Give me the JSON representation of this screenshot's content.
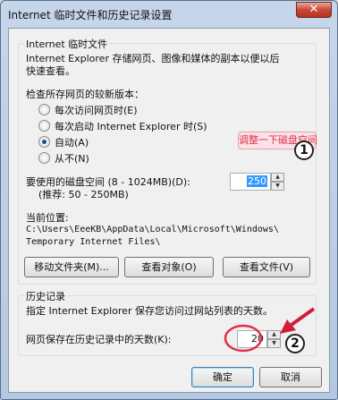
{
  "window": {
    "title": "Internet 临时文件和历史记录设置",
    "close_label": "✕"
  },
  "temp_files": {
    "group_title": "Internet 临时文件",
    "desc_line1": "Internet Explorer 存储网页、图像和媒体的副本以便以后",
    "desc_line2": "快速查看。",
    "check_label": "检查所存网页的较新版本：",
    "options": [
      {
        "label": "每次访问网页时(E)",
        "checked": false
      },
      {
        "label": "每次启动 Internet Explorer 时(S)",
        "checked": false
      },
      {
        "label": "自动(A)",
        "checked": true
      },
      {
        "label": "从不(N)",
        "checked": false
      }
    ],
    "disk_label": "要使用的磁盘空间 (8 - 1024MB)(D):",
    "disk_recommend": "(推荐: 50 - 250MB)",
    "disk_value": "250",
    "location_label": "当前位置:",
    "location_line1": "C:\\Users\\EeeKB\\AppData\\Local\\Microsoft\\Windows\\",
    "location_line2": "Temporary Internet Files\\",
    "buttons": {
      "move": "移动文件夹(M)...",
      "view_objects": "查看对象(O)",
      "view_files": "查看文件(V)"
    }
  },
  "history": {
    "group_title": "历史记录",
    "desc": "指定 Internet Explorer 保存您访问过网站列表的天数。",
    "days_label": "网页保存在历史记录中的天数(K):",
    "days_value": "20"
  },
  "footer": {
    "ok": "确定",
    "cancel": "取消"
  },
  "annotations": {
    "callout_text": "调整一下磁盘空间",
    "marker1": "1",
    "marker2": "2",
    "accent_color": "#e0304a"
  }
}
